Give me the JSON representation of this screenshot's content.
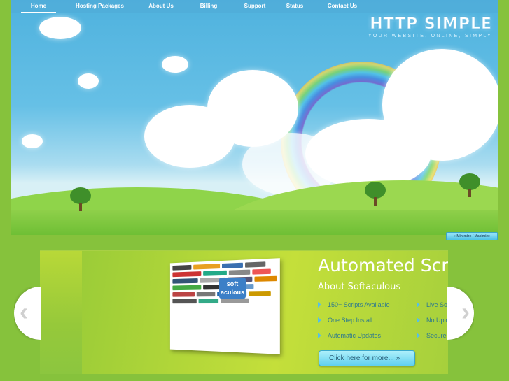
{
  "nav": {
    "items": [
      "Home",
      "Hosting Packages",
      "About Us",
      "Billing",
      "Support",
      "Status",
      "Contact Us"
    ],
    "active": "Home"
  },
  "logo": {
    "title": "HTTP SIMPLE",
    "tagline": "YOUR WEBSITE, ONLINE, SIMPLY"
  },
  "banner": {
    "minmax_label": "» Minimize / Maximize"
  },
  "slide": {
    "headline": "Automated Script Insta",
    "subheading": "About Softaculous",
    "features_left": [
      "150+ Scripts Available",
      "One Step Install",
      "Automatic Updates"
    ],
    "features_right": [
      "Live Script Demo's",
      "No Uploading and Dow",
      "Secure Script Setup"
    ],
    "button_label": "Click here for more...  »",
    "collage_badge": "soft aculous"
  },
  "arrows": {
    "prev": "‹",
    "next": "›"
  }
}
